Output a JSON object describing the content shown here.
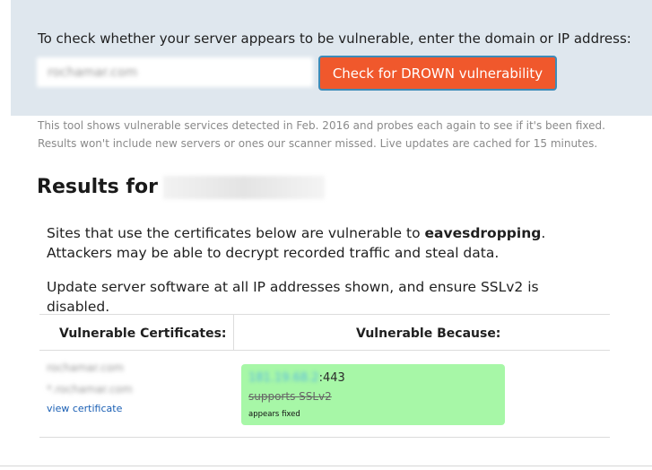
{
  "check": {
    "prompt": "To check whether your server appears to be vulnerable, enter the domain or IP address:",
    "input_value": "rochamar.com",
    "button_label": "Check for DROWN vulnerability"
  },
  "notes": {
    "line1": "This tool shows vulnerable services detected in Feb. 2016 and probes each again to see if it's been fixed.",
    "line2": "Results won't include new servers or ones our scanner missed. Live updates are cached for 15 minutes."
  },
  "results": {
    "heading": "Results for",
    "para1_before": "Sites that use the certificates below are vulnerable to ",
    "para1_bold": "eavesdropping",
    "para1_after": ". Attackers may be able to decrypt recorded traffic and steal data.",
    "para2": "Update server software at all IP addresses shown, and ensure SSLv2 is disabled.",
    "table": {
      "headers": [
        "Vulnerable Certificates:",
        "Vulnerable Because:"
      ],
      "rows": [
        {
          "cert_lines": [
            "rochamar.com",
            "*.rochamar.com"
          ],
          "view_link": "view certificate",
          "ip": "181.19.68.2",
          "port_suffix": ":443",
          "reason": "supports SSLv2",
          "status": "appears fixed"
        }
      ]
    }
  },
  "colors": {
    "panel_bg": "#dfe7ee",
    "button_bg": "#f0582c",
    "button_border": "#3d8bb8",
    "fixed_box_bg": "#a7f7a7",
    "link": "#1a5fb4"
  }
}
